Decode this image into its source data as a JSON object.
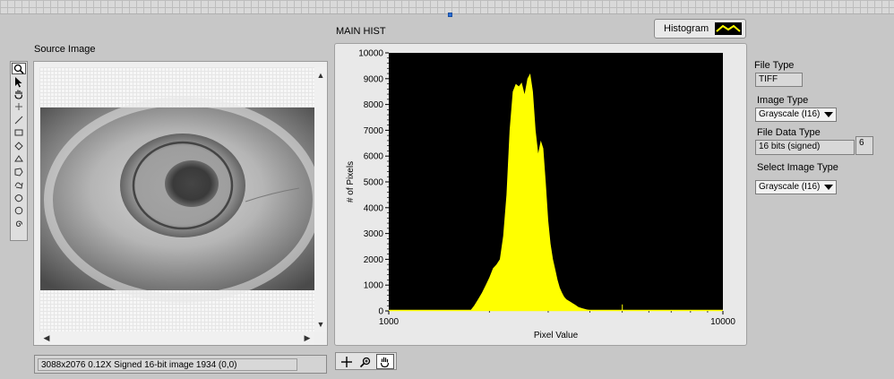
{
  "source_image": {
    "label": "Source Image",
    "status_text": "3088x2076 0.12X Signed 16-bit image 1934    (0,0)"
  },
  "histogram": {
    "title": "MAIN HIST",
    "mode_button": "Histogram",
    "chart_data": {
      "type": "area",
      "xlabel": "Pixel Value",
      "ylabel": "# of Pixels",
      "xscale": "log",
      "xlim": [
        1000,
        10000
      ],
      "ylim": [
        0,
        10000
      ],
      "x_tick_labels": [
        "1000",
        "10000"
      ],
      "y_tick_labels": [
        "0",
        "1000",
        "2000",
        "3000",
        "4000",
        "5000",
        "6000",
        "7000",
        "8000",
        "9000",
        "10000"
      ],
      "fill_color": "#ffff00",
      "background": "#000000",
      "x": [
        1750,
        1800,
        1850,
        1900,
        1950,
        2000,
        2050,
        2100,
        2150,
        2200,
        2250,
        2300,
        2350,
        2400,
        2450,
        2500,
        2550,
        2600,
        2650,
        2700,
        2750,
        2800,
        2850,
        2900,
        2950,
        3000,
        3050,
        3100,
        3150,
        3200,
        3250,
        3300,
        3350,
        3400,
        3450,
        3500,
        3550,
        3600,
        3650,
        3700,
        3800,
        3900,
        4000,
        4100,
        4250
      ],
      "y": [
        0,
        200,
        450,
        700,
        1000,
        1300,
        1650,
        1800,
        2000,
        2900,
        4500,
        7000,
        8500,
        8800,
        8700,
        8850,
        8400,
        9000,
        9200,
        8500,
        7000,
        6100,
        6600,
        6300,
        5000,
        3500,
        2600,
        2000,
        1600,
        1200,
        900,
        700,
        550,
        450,
        400,
        350,
        300,
        250,
        200,
        150,
        100,
        60,
        30,
        10,
        0
      ],
      "spike": {
        "x": 5000,
        "y": 250
      }
    },
    "tools": [
      "crosshair-icon",
      "zoom-icon",
      "pan-icon"
    ]
  },
  "file_info": {
    "file_type_label": "File Type",
    "file_type_value": "TIFF",
    "image_type_label": "Image Type",
    "image_type_value": "Grayscale (I16)",
    "file_data_type_label": "File Data Type",
    "file_data_type_value": "16 bits (signed)",
    "file_data_type_code": "6",
    "select_image_type_label": "Select Image Type",
    "select_image_type_value": "Grayscale (I16)"
  }
}
